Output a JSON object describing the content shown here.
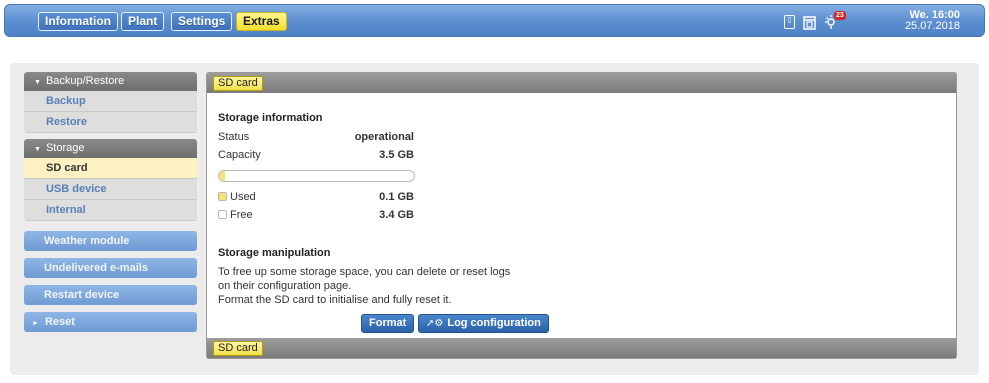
{
  "header": {
    "tabs": [
      {
        "label": "Information"
      },
      {
        "label": "Plant"
      },
      {
        "label": "Settings"
      },
      {
        "label": "Extras"
      }
    ],
    "notification_count": "23",
    "day_time": "We. 16:00",
    "date": "25.07.2018"
  },
  "sidebar": {
    "groups": [
      {
        "title": "Backup/Restore",
        "items": [
          "Backup",
          "Restore"
        ]
      },
      {
        "title": "Storage",
        "items": [
          "SD card",
          "USB device",
          "Internal"
        ]
      }
    ],
    "buttons": [
      "Weather module",
      "Undelivered e-mails",
      "Restart device",
      "Reset"
    ]
  },
  "panel": {
    "title": "SD card",
    "storage_info": {
      "heading": "Storage information",
      "status_label": "Status",
      "status_value": "operational",
      "capacity_label": "Capacity",
      "capacity_value": "3.5 GB",
      "used_fraction": 0.03,
      "used_label": "Used",
      "used_value": "0.1 GB",
      "free_label": "Free",
      "free_value": "3.4 GB"
    },
    "manipulation": {
      "heading": "Storage manipulation",
      "text1": "To free up some storage space, you can delete or reset logs on their configuration page.",
      "text2": "Format the SD card to initialise and fully reset it.",
      "format_label": "Format",
      "log_config_label": "Log configuration"
    },
    "footer_title": "SD card"
  },
  "colors": {
    "header_blue": "#5b8ed0",
    "active_tab_yellow": "#f1df2a",
    "used_fill": "#f6e47a",
    "button_blue": "#2a62aa"
  }
}
